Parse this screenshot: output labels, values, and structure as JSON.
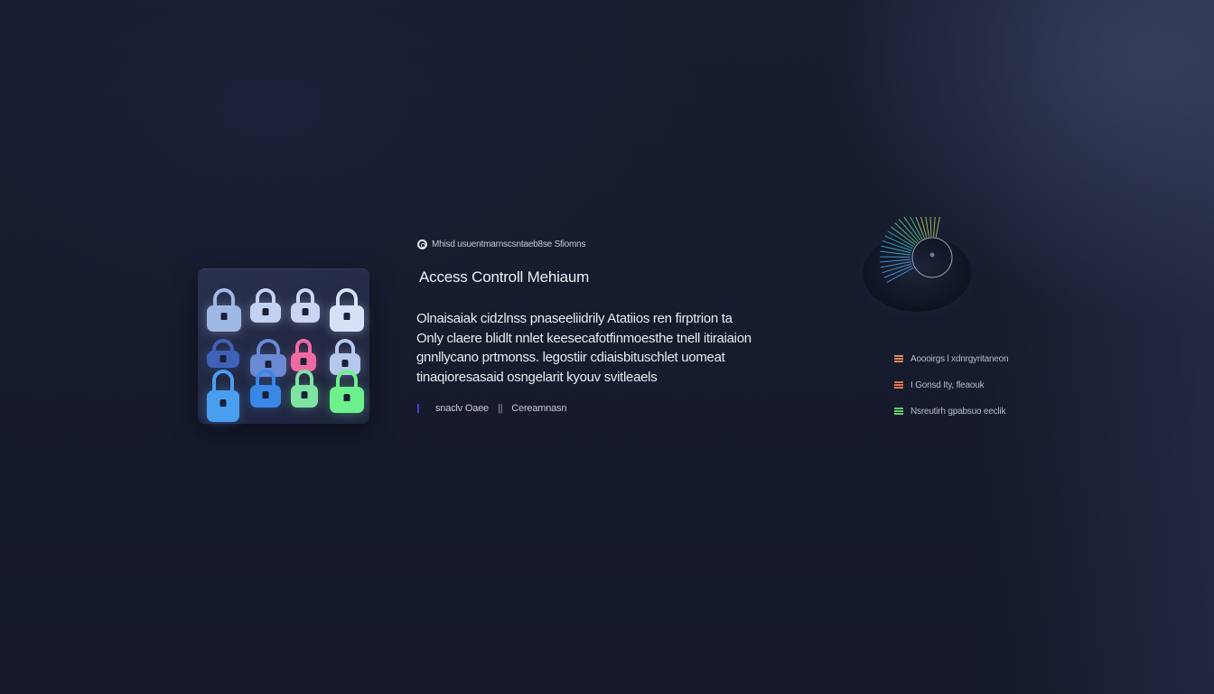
{
  "header": {
    "info_icon": "info-circle-icon",
    "info_text": "Mhisd usuentmarnscsntaeb8se Sfiomns"
  },
  "title": "Access Controll Mehiaum",
  "body": {
    "lines": [
      "Olnaisaiak cidzlnss pnaseeliidrily Atatiios ren firptrion ta",
      "Only claere blidlt nnlet keesecafotfinmoesthe tnell itiraiaion",
      "gnnllycano prtmonss. legostiir cdiaisbituschlet uomeat",
      "tinaqioresasaid osngelarit kyouv svitleaels"
    ]
  },
  "meta": {
    "left": "snaclv Oaee",
    "separator": "||",
    "right": "Cereamnasn"
  },
  "locks": [
    {
      "row": 0,
      "col": 0,
      "color": "#9fb8e6"
    },
    {
      "row": 0,
      "col": 1,
      "color": "#c3d2f1"
    },
    {
      "row": 0,
      "col": 2,
      "color": "#c9d5f2"
    },
    {
      "row": 0,
      "col": 3,
      "color": "#d7e1f6"
    },
    {
      "row": 1,
      "col": 0,
      "color": "#3f61b8"
    },
    {
      "row": 1,
      "col": 1,
      "color": "#6a8ad4"
    },
    {
      "row": 1,
      "col": 2,
      "color": "#f06aa4"
    },
    {
      "row": 1,
      "col": 3,
      "color": "#b5c8ee"
    },
    {
      "row": 2,
      "col": 0,
      "color": "#4a9ef0"
    },
    {
      "row": 2,
      "col": 1,
      "color": "#3a87e6"
    },
    {
      "row": 2,
      "col": 2,
      "color": "#7ee4a4"
    },
    {
      "row": 2,
      "col": 3,
      "color": "#6ef08c"
    }
  ],
  "dial": {
    "icon": "gauge-dial-icon",
    "ray_colors": [
      "#5ab0ff",
      "#3ad6e6",
      "#5ee89a",
      "#c6e86a"
    ]
  },
  "legend": [
    {
      "label": "Aoooirgs l xdnrgyritaneon",
      "color": "#d9895a",
      "icon": "list-icon"
    },
    {
      "label": "I  Gonsd Ity, fleaouk",
      "color": "#e5734f",
      "icon": "list-icon"
    },
    {
      "label": "Nsreutirh gpabsuo eeclik",
      "color": "#5fd06a",
      "icon": "list-icon"
    }
  ]
}
